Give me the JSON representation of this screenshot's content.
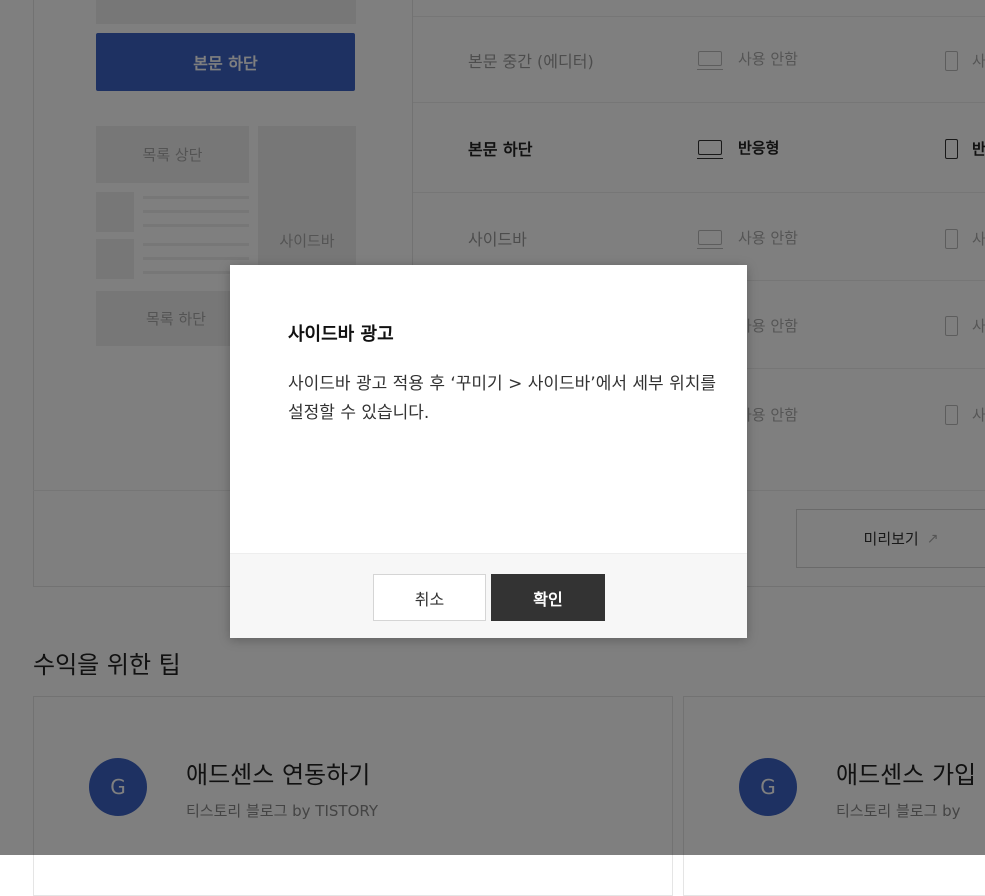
{
  "preview": {
    "active_block": "본문 하단",
    "list_top": "목록 상단",
    "sidebar": "사이드바",
    "list_bottom": "목록 하단"
  },
  "ad_rows": [
    {
      "label": "본문 중간 (에디터)",
      "pc": "사용 안함",
      "mobile": "사"
    },
    {
      "label": "본문 하단",
      "pc": "반응형",
      "mobile": "반"
    },
    {
      "label": "사이드바",
      "pc": "사용 안함",
      "mobile": "사"
    },
    {
      "label": "",
      "pc": "사용 안함",
      "mobile": "사"
    },
    {
      "label": "",
      "pc": "사용 안함",
      "mobile": "사"
    }
  ],
  "preview_button": "미리보기",
  "tips": {
    "section_title": "수익을 위한 팁",
    "cards": [
      {
        "icon_letter": "G",
        "title": "애드센스 연동하기",
        "subtitle": "티스토리 블로그 by TISTORY"
      },
      {
        "icon_letter": "G",
        "title": "애드센스 가입",
        "subtitle": "티스토리 블로그 by"
      }
    ]
  },
  "modal": {
    "title": "사이드바 광고",
    "body": "사이드바 광고 적용 후 ‘꾸미기 > 사이드바’에서 세부 위치를 설정할 수 있습니다.",
    "cancel": "취소",
    "confirm": "확인"
  },
  "colors": {
    "accent": "#3c62c5",
    "confirm_button": "#333333",
    "overlay": "rgba(0,0,0,0.5)"
  },
  "icons": {
    "pc": "monitor-icon",
    "mobile": "mobile-icon",
    "external_link": "external-link-icon",
    "google": "google-g-icon"
  }
}
